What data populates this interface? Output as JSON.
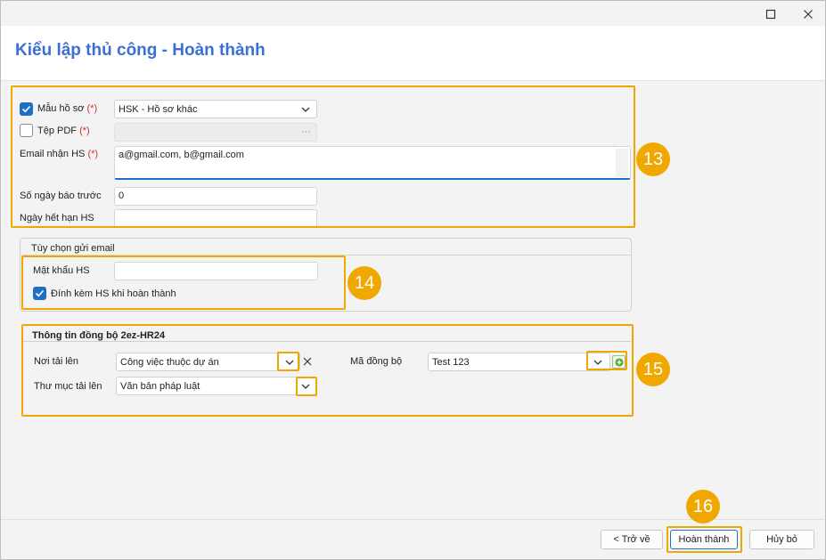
{
  "window": {
    "maximize_icon": "maximize-icon",
    "close_icon": "close-icon"
  },
  "header": {
    "title": "Kiểu lập thủ công - Hoàn thành"
  },
  "form": {
    "template": {
      "label": "Mẫu hồ sơ",
      "required": "(*)",
      "checked": true,
      "value": "HSK - Hồ sơ khác"
    },
    "pdf": {
      "label": "Tệp PDF",
      "required": "(*)",
      "checked": false,
      "browse": "···"
    },
    "email": {
      "label": "Email nhận HS",
      "required": "(*)",
      "value": "a@gmail.com, b@gmail.com"
    },
    "notice_days": {
      "label": "Số ngày báo trước",
      "value": "0"
    },
    "expiry": {
      "label": "Ngày hết hạn HS",
      "value": ""
    }
  },
  "email_options": {
    "title": "Tùy chọn gửi email",
    "password": {
      "label": "Mật khẩu HS",
      "value": ""
    },
    "attach": {
      "label": "Đính kèm HS khi hoàn thành",
      "checked": true
    }
  },
  "sync": {
    "title": "Thông tin đồng bộ 2ez-HR24",
    "upload_location": {
      "label": "Nơi tải lên",
      "value": "Công việc thuộc dự án"
    },
    "upload_folder": {
      "label": "Thư mục tải lên",
      "value": "Văn bản pháp luật"
    },
    "sync_code": {
      "label": "Mã đồng bộ",
      "value": "Test 123"
    }
  },
  "badges": [
    "13",
    "14",
    "15",
    "16"
  ],
  "footer": {
    "back": "< Trở về",
    "finish": "Hoàn thành",
    "cancel": "Hủy bỏ"
  },
  "colors": {
    "accent": "#3b6fd4",
    "highlight": "#f0a800",
    "checkbox": "#1f6fc5",
    "required": "#d32f2f"
  }
}
